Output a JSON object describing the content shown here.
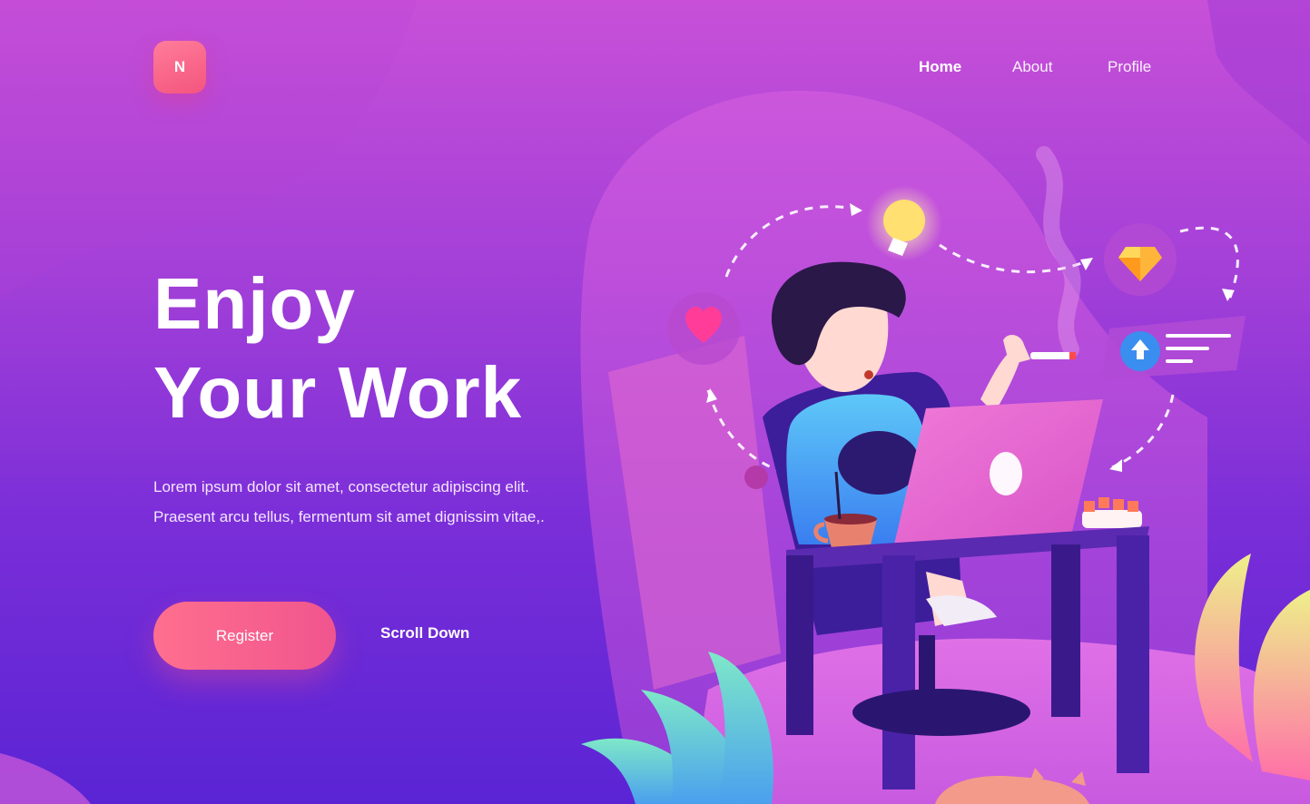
{
  "brand": {
    "logo_letter": "N"
  },
  "nav": {
    "items": [
      {
        "label": "Home",
        "active": true
      },
      {
        "label": "About",
        "active": false
      },
      {
        "label": "Profile",
        "active": false
      }
    ]
  },
  "hero": {
    "headline_line1": "Enjoy",
    "headline_line2": "Your Work",
    "description": "Lorem ipsum dolor sit amet, consectetur adipiscing elit. Praesent arcu tellus, fermentum sit amet dignissim vitae,.",
    "register_label": "Register",
    "scroll_label": "Scroll Down"
  },
  "illustration": {
    "icons": [
      "heart-icon",
      "lightbulb-icon",
      "sketch-diamond-icon",
      "upload-icon"
    ]
  },
  "colors": {
    "accent": "#f4557e",
    "bg_top": "#c850d8",
    "bg_bottom": "#5a24d4"
  }
}
